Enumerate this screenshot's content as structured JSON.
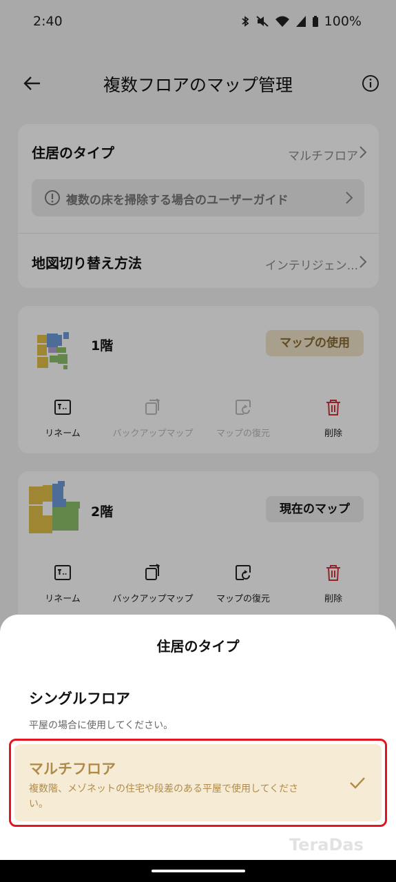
{
  "status_bar": {
    "time": "2:40",
    "battery": "100%"
  },
  "header": {
    "title": "複数フロアのマップ管理"
  },
  "settings": {
    "residence_type_label": "住居のタイプ",
    "residence_type_value": "マルチフロア",
    "guide_text": "複数の床を掃除する場合のユーザーガイド",
    "map_switch_label": "地図切り替え方法",
    "map_switch_value": "インテリジェン..."
  },
  "floors": [
    {
      "name": "1階",
      "button": "マップの使用",
      "actions": {
        "rename": "リネーム",
        "backup": "バックアップマップ",
        "restore": "マップの復元",
        "delete": "削除"
      }
    },
    {
      "name": "2階",
      "button": "現在のマップ",
      "actions": {
        "rename": "リネーム",
        "backup": "バックアップマップ",
        "restore": "マップの復元",
        "delete": "削除"
      }
    }
  ],
  "sheet": {
    "title": "住居のタイプ",
    "options": [
      {
        "name": "シングルフロア",
        "desc": "平屋の場合に使用してください。"
      },
      {
        "name": "マルチフロア",
        "desc": "複数階、メゾネットの住宅や段差のある平屋で使用してください。"
      }
    ],
    "selected": "マルチフロア"
  },
  "watermark": "TeraDas",
  "colors": {
    "accent": "#b08a4a",
    "selected_bg": "#f6ecd6",
    "danger": "#d0343a",
    "highlight_frame": "#e3141e"
  }
}
